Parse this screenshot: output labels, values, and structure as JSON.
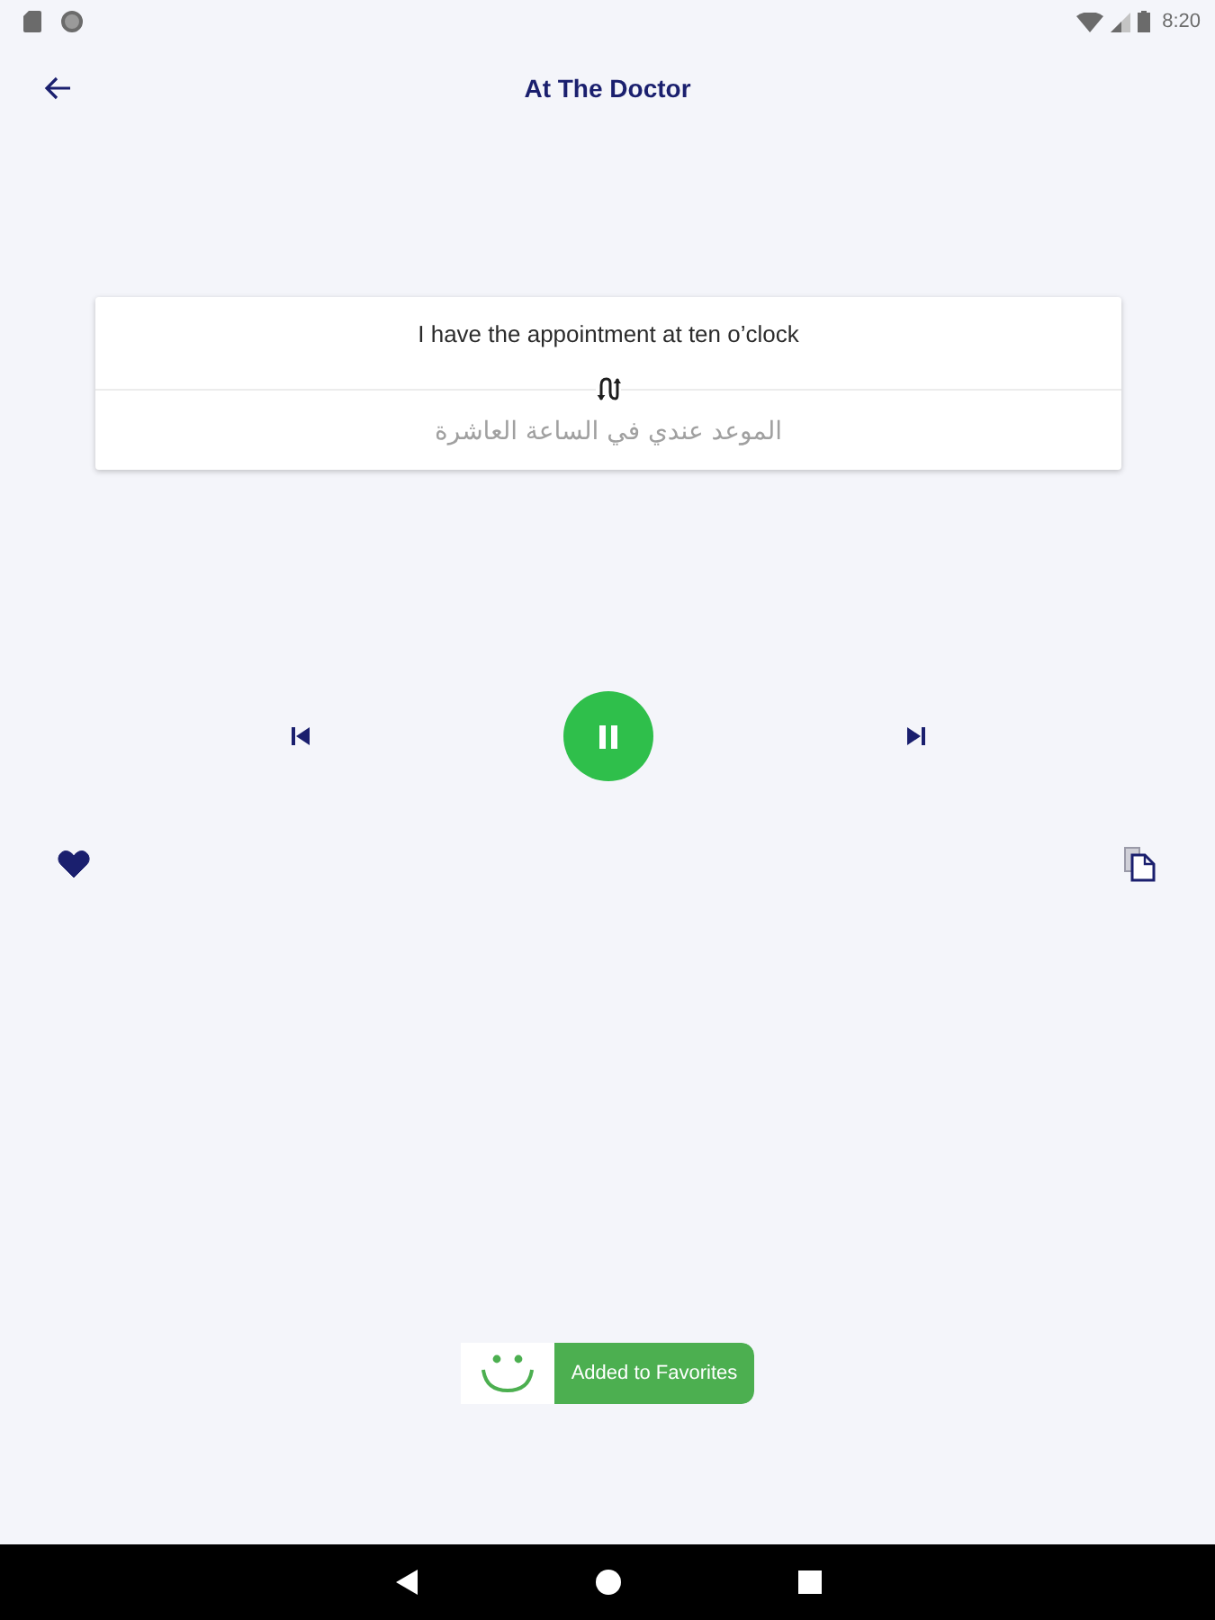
{
  "status_bar": {
    "time": "8:20"
  },
  "app_bar": {
    "title": "At The Doctor"
  },
  "phrase": {
    "english": "I have the appointment at ten o’clock",
    "arabic": "الموعد عندي في الساعة العاشرة"
  },
  "player": {
    "playing": true
  },
  "actions": {
    "favorite": true
  },
  "toast": {
    "message": "Added to Favorites"
  }
}
